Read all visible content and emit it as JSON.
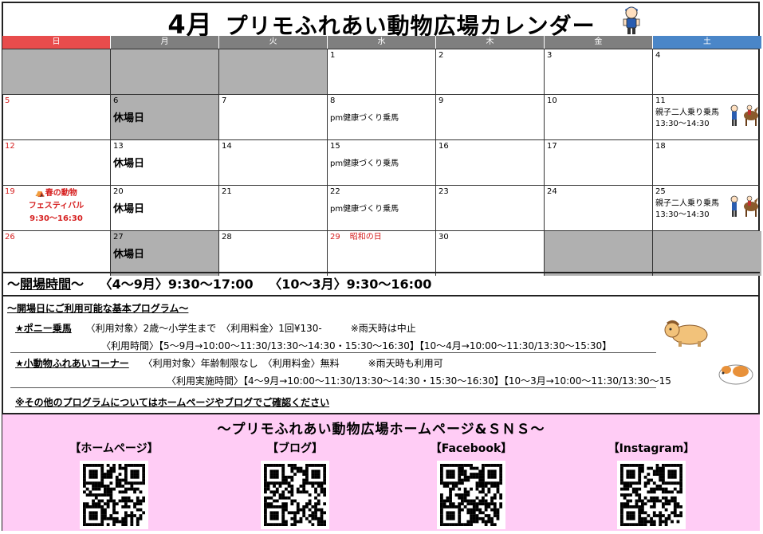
{
  "title": {
    "month": "4月",
    "text": "プリモふれあい動物広場カレンダー"
  },
  "days_of_week": [
    "日",
    "月",
    "火",
    "水",
    "木",
    "金",
    "土"
  ],
  "weeks": [
    [
      {
        "n": "",
        "gray": true
      },
      {
        "n": "",
        "gray": true
      },
      {
        "n": "",
        "gray": true
      },
      {
        "n": "1"
      },
      {
        "n": "2"
      },
      {
        "n": "3"
      },
      {
        "n": "4"
      }
    ],
    [
      {
        "n": "5",
        "red": true
      },
      {
        "n": "6",
        "gray": true,
        "closed": "休場日"
      },
      {
        "n": "7"
      },
      {
        "n": "8",
        "ev": "pm健康づくり乗馬"
      },
      {
        "n": "9"
      },
      {
        "n": "10"
      },
      {
        "n": "11",
        "ev": "親子二人乗り乗馬",
        "time": "13:30～14:30",
        "riders": true
      }
    ],
    [
      {
        "n": "12",
        "red": true
      },
      {
        "n": "13",
        "closed": "休場日"
      },
      {
        "n": "14"
      },
      {
        "n": "15",
        "ev": "pm健康づくり乗馬"
      },
      {
        "n": "16"
      },
      {
        "n": "17"
      },
      {
        "n": "18"
      }
    ],
    [
      {
        "n": "19",
        "red": true,
        "fest": [
          "⛺春の動物",
          "フェスティバル",
          "9:30～16:30"
        ]
      },
      {
        "n": "20",
        "closed": "休場日"
      },
      {
        "n": "21"
      },
      {
        "n": "22",
        "ev": "pm健康づくり乗馬"
      },
      {
        "n": "23"
      },
      {
        "n": "24"
      },
      {
        "n": "25",
        "ev": "親子二人乗り乗馬",
        "time": "13:30～14:30",
        "riders": true
      }
    ],
    [
      {
        "n": "26",
        "red": true
      },
      {
        "n": "27",
        "gray": true,
        "closed": "休場日"
      },
      {
        "n": "28"
      },
      {
        "n": "29",
        "red": true,
        "holiday": "昭和の日"
      },
      {
        "n": "30"
      },
      {
        "n": "",
        "gray": true
      },
      {
        "n": "",
        "gray": true
      }
    ]
  ],
  "hours": {
    "label": "開場時間",
    "prefix": "～",
    "suffix": "～",
    "summer": "〈4～9月〉9:30～17:00",
    "winter": "〈10～3月〉9:30～16:00"
  },
  "programs": {
    "heading": "～開場日にご利用可能な基本プログラム～",
    "pony": {
      "name": "★ポニー乗馬",
      "line1": "〈利用対象〉2歳～小学生まで　〈利用料金〉1回¥130-　　　※雨天時は中止",
      "line2": "〈利用時間〉【5～9月→10:00～11:30/13:30～14:30・15:30～16:30】【10～4月→10:00～11:30/13:30～15:30】"
    },
    "small_animals": {
      "name": "★小動物ふれあいコーナー",
      "line1": "〈利用対象〉年齢制限なし　〈利用料金〉無料　　　※雨天時も利用可",
      "line2": "〈利用実施時間〉【4～9月→10:00～11:30/13:30～14:30・15:30～16:30】【10～3月→10:00～11:30/13:30～15"
    },
    "note": "※その他のプログラムについてはホームページやブログでご確認ください"
  },
  "sns": {
    "title": "～プリモふれあい動物広場ホームページ&ＳＮＳ～",
    "items": [
      "【ホームページ】",
      "【ブログ】",
      "【Facebook】",
      "【Instagram】"
    ]
  },
  "colors": {
    "sunday": "#e84c4c",
    "saturday": "#4a86c8",
    "weekday": "#7f7f7f",
    "closed_gray": "#b0b0b0",
    "sns_bg": "#ffccf5",
    "red_text": "#d62020"
  }
}
